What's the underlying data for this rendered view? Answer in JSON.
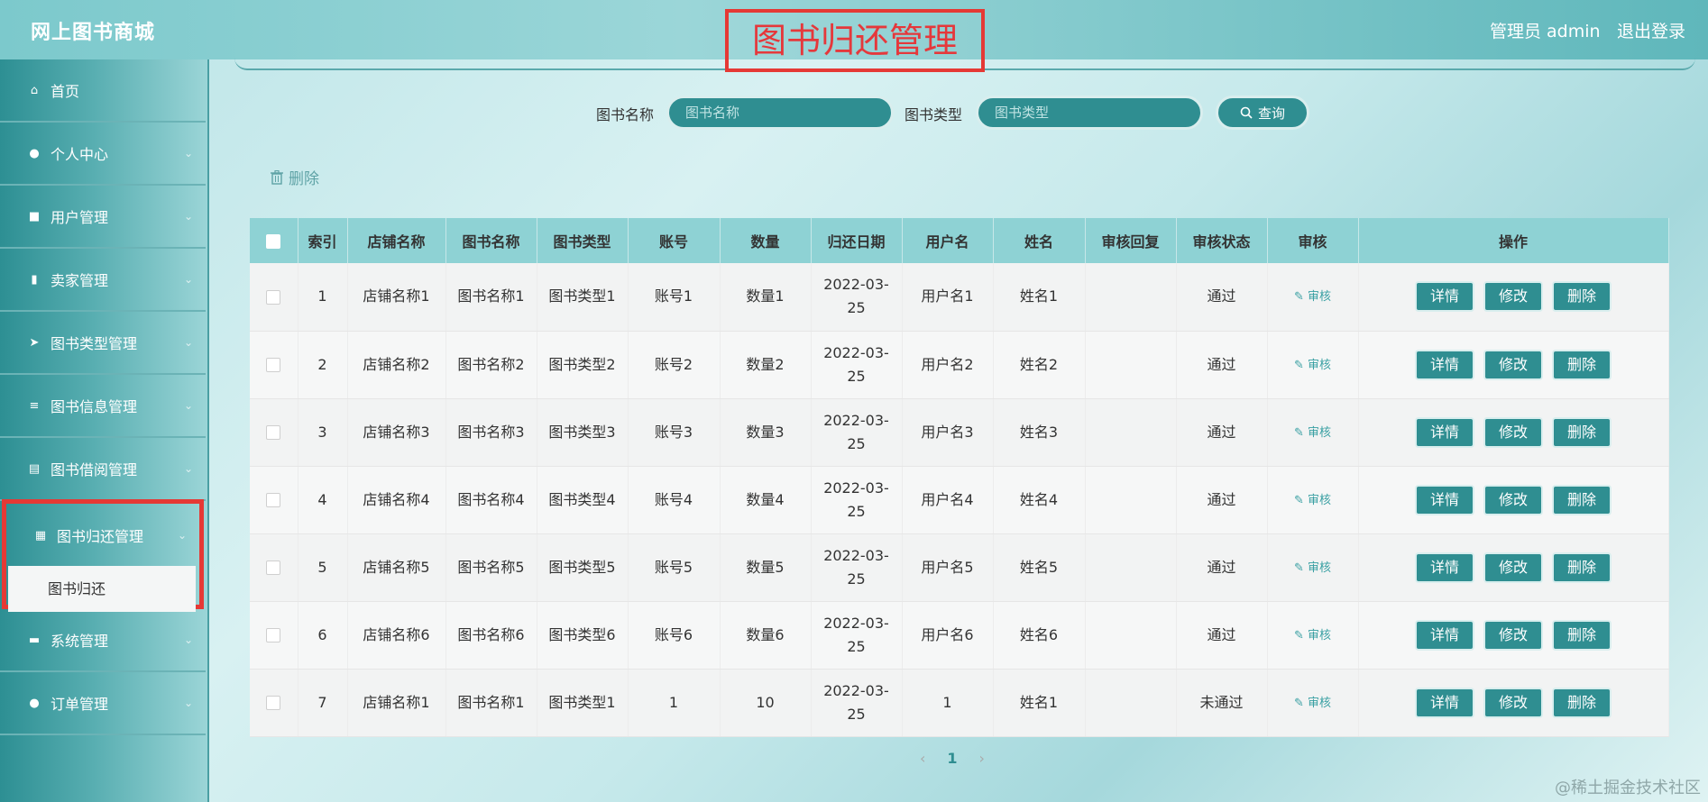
{
  "header": {
    "brand": "网上图书商城",
    "page_title": "图书归还管理",
    "admin_label": "管理员 admin",
    "logout": "退出登录"
  },
  "sidebar": {
    "items": [
      {
        "label": "首页",
        "icon": "home-icon",
        "has_children": false
      },
      {
        "label": "个人中心",
        "icon": "user-icon",
        "has_children": true
      },
      {
        "label": "用户管理",
        "icon": "user-manage-icon",
        "has_children": true
      },
      {
        "label": "卖家管理",
        "icon": "seller-icon",
        "has_children": true
      },
      {
        "label": "图书类型管理",
        "icon": "send-icon",
        "has_children": true
      },
      {
        "label": "图书信息管理",
        "icon": "list-icon",
        "has_children": true
      },
      {
        "label": "图书借阅管理",
        "icon": "chart-icon",
        "has_children": true
      },
      {
        "label": "图书归还管理",
        "icon": "grid-icon",
        "has_children": true,
        "active": true
      },
      {
        "label": "系统管理",
        "icon": "ticket-icon",
        "has_children": true
      },
      {
        "label": "订单管理",
        "icon": "bulb-icon",
        "has_children": true
      }
    ],
    "submenu_label": "图书归还"
  },
  "search": {
    "book_name_label": "图书名称",
    "book_name_placeholder": "图书名称",
    "book_type_label": "图书类型",
    "book_type_placeholder": "图书类型",
    "query_label": "查询"
  },
  "toolbar": {
    "delete_label": "删除"
  },
  "table": {
    "columns": [
      "索引",
      "店铺名称",
      "图书名称",
      "图书类型",
      "账号",
      "数量",
      "归还日期",
      "用户名",
      "姓名",
      "审核回复",
      "审核状态",
      "审核",
      "操作"
    ],
    "audit_label": "审核",
    "actions": {
      "detail": "详情",
      "edit": "修改",
      "delete": "删除"
    },
    "rows": [
      {
        "index": "1",
        "shop": "店铺名称1",
        "book": "图书名称1",
        "type": "图书类型1",
        "account": "账号1",
        "qty": "数量1",
        "date1": "2022-03-",
        "date2": "25",
        "username": "用户名1",
        "name": "姓名1",
        "reply": "",
        "status": "通过"
      },
      {
        "index": "2",
        "shop": "店铺名称2",
        "book": "图书名称2",
        "type": "图书类型2",
        "account": "账号2",
        "qty": "数量2",
        "date1": "2022-03-",
        "date2": "25",
        "username": "用户名2",
        "name": "姓名2",
        "reply": "",
        "status": "通过"
      },
      {
        "index": "3",
        "shop": "店铺名称3",
        "book": "图书名称3",
        "type": "图书类型3",
        "account": "账号3",
        "qty": "数量3",
        "date1": "2022-03-",
        "date2": "25",
        "username": "用户名3",
        "name": "姓名3",
        "reply": "",
        "status": "通过"
      },
      {
        "index": "4",
        "shop": "店铺名称4",
        "book": "图书名称4",
        "type": "图书类型4",
        "account": "账号4",
        "qty": "数量4",
        "date1": "2022-03-",
        "date2": "25",
        "username": "用户名4",
        "name": "姓名4",
        "reply": "",
        "status": "通过"
      },
      {
        "index": "5",
        "shop": "店铺名称5",
        "book": "图书名称5",
        "type": "图书类型5",
        "account": "账号5",
        "qty": "数量5",
        "date1": "2022-03-",
        "date2": "25",
        "username": "用户名5",
        "name": "姓名5",
        "reply": "",
        "status": "通过"
      },
      {
        "index": "6",
        "shop": "店铺名称6",
        "book": "图书名称6",
        "type": "图书类型6",
        "account": "账号6",
        "qty": "数量6",
        "date1": "2022-03-",
        "date2": "25",
        "username": "用户名6",
        "name": "姓名6",
        "reply": "",
        "status": "通过"
      },
      {
        "index": "7",
        "shop": "店铺名称1",
        "book": "图书名称1",
        "type": "图书类型1",
        "account": "1",
        "qty": "10",
        "date1": "2022-03-",
        "date2": "25",
        "username": "1",
        "name": "姓名1",
        "reply": "",
        "status": "未通过"
      }
    ]
  },
  "pagination": {
    "prev": "‹",
    "current": "1",
    "next": "›"
  },
  "watermark": "@稀土掘金技术社区",
  "colors": {
    "accent": "#2f8e91",
    "header": "#8ed2d4",
    "highlight": "#e53935"
  }
}
